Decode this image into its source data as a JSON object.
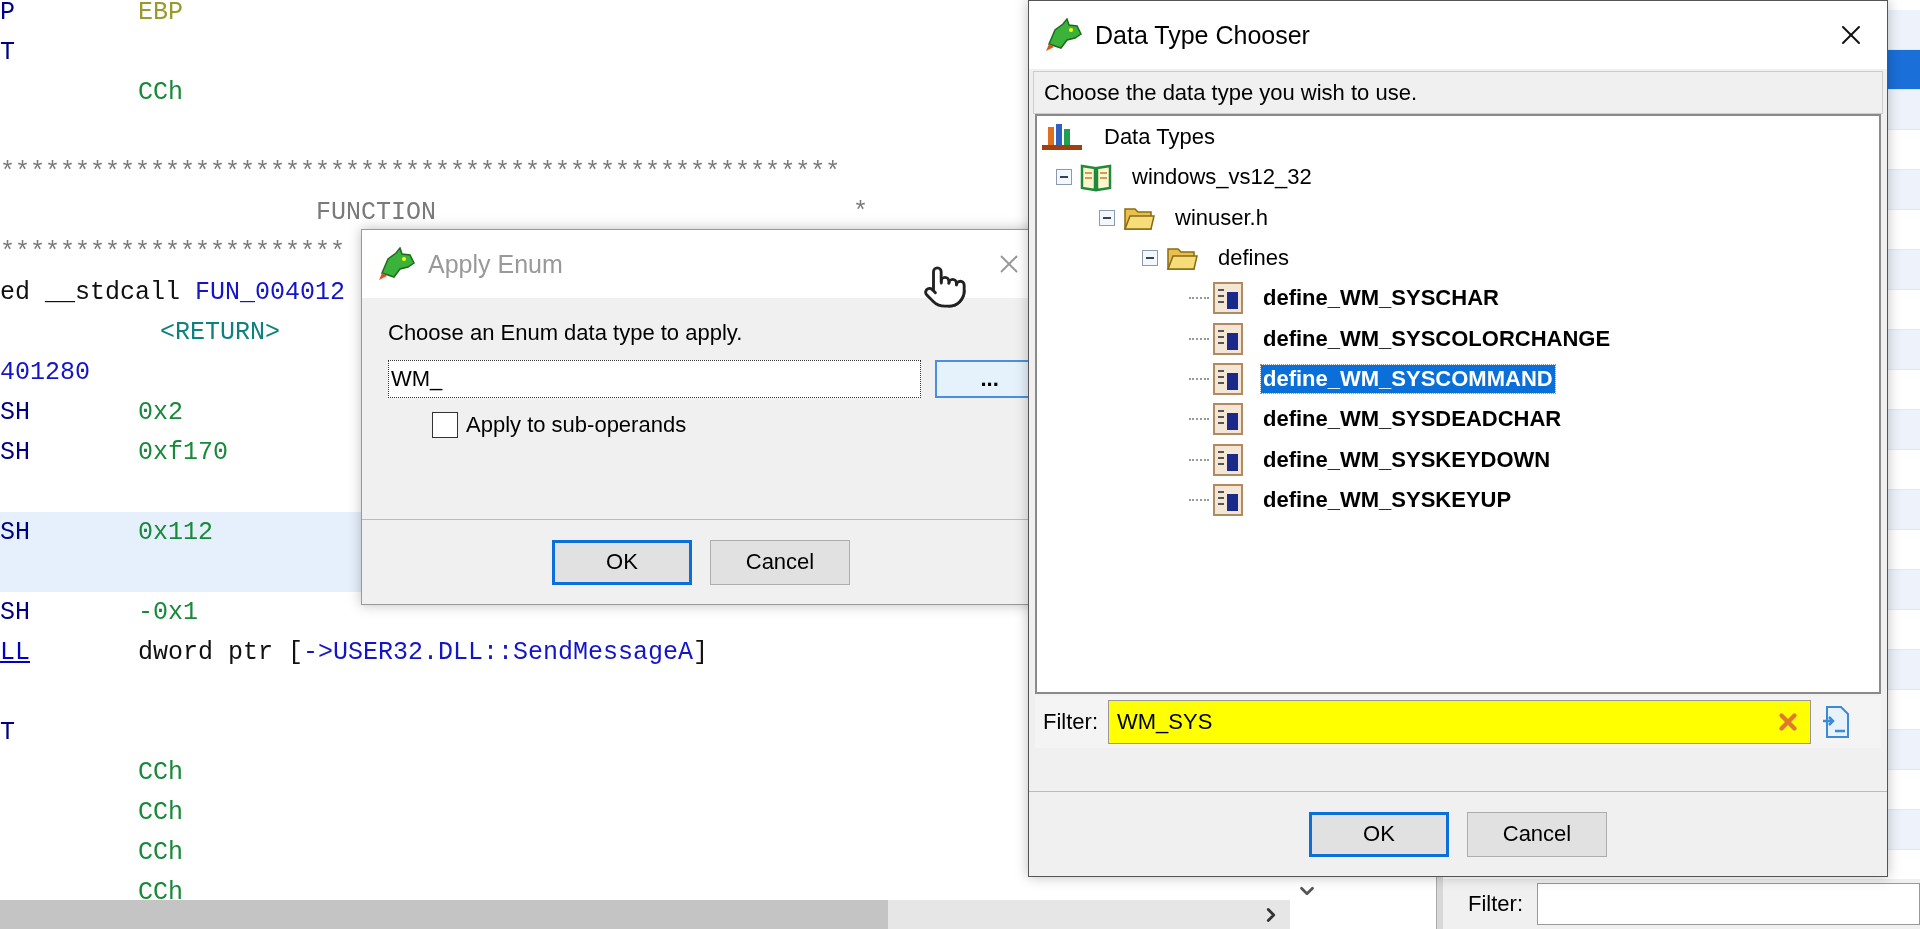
{
  "listing": {
    "lines": [
      {
        "kind": "instr",
        "mnemonic": "P",
        "operand": [
          {
            "text": "EBP",
            "kind": "register"
          }
        ],
        "selected": false
      },
      {
        "kind": "instr",
        "mnemonic": "T",
        "selected": false
      },
      {
        "kind": "instr",
        "operand": [
          {
            "text": "CCh",
            "kind": "scalar"
          }
        ],
        "selected": false
      },
      {
        "kind": "blank",
        "selected": false
      },
      {
        "kind": "stars",
        "text": "********************************************************",
        "selected": false
      },
      {
        "kind": "title",
        "text": "FUNCTION",
        "end": "*",
        "selected": false
      },
      {
        "kind": "stars",
        "text": "***********************",
        "selected": false
      },
      {
        "kind": "signature",
        "parts": [
          {
            "text": "ed __stdcall ",
            "kind": "plain"
          },
          {
            "text": "FUN_004012",
            "kind": "label"
          }
        ],
        "selected": false
      },
      {
        "kind": "return",
        "text": "<RETURN>",
        "selected": false
      },
      {
        "kind": "address",
        "text": "401280",
        "selected": false
      },
      {
        "kind": "instr",
        "mnemonic": "SH",
        "operand": [
          {
            "text": "0x2",
            "kind": "scalar"
          }
        ],
        "selected": false
      },
      {
        "kind": "instr",
        "mnemonic": "SH",
        "operand": [
          {
            "text": "0xf170",
            "kind": "scalar"
          }
        ],
        "selected": false
      },
      {
        "kind": "blank",
        "selected": false
      },
      {
        "kind": "instr",
        "mnemonic": "SH",
        "operand": [
          {
            "text": "0x112",
            "kind": "scalar"
          }
        ],
        "selected": true
      },
      {
        "kind": "blank",
        "selected": true
      },
      {
        "kind": "instr",
        "mnemonic": "SH",
        "operand": [
          {
            "text": "-0x1",
            "kind": "scalar"
          }
        ],
        "selected": false
      },
      {
        "kind": "instr",
        "mnemonic": "LL",
        "mnemonic_link": true,
        "operand": [
          {
            "text": "dword ptr [",
            "kind": "plain"
          },
          {
            "text": "->USER32.DLL::SendMessageA",
            "kind": "label"
          },
          {
            "text": "]",
            "kind": "plain"
          }
        ],
        "selected": false
      },
      {
        "kind": "blank",
        "selected": false
      },
      {
        "kind": "instr",
        "mnemonic": "T",
        "selected": false
      },
      {
        "kind": "instr",
        "operand": [
          {
            "text": "CCh",
            "kind": "scalar"
          }
        ],
        "selected": false
      },
      {
        "kind": "instr",
        "operand": [
          {
            "text": "CCh",
            "kind": "scalar"
          }
        ],
        "selected": false
      },
      {
        "kind": "instr",
        "operand": [
          {
            "text": "CCh",
            "kind": "scalar"
          }
        ],
        "selected": false
      },
      {
        "kind": "instr",
        "operand": [
          {
            "text": "CCh",
            "kind": "scalar"
          }
        ],
        "selected": false
      }
    ]
  },
  "side_list": {
    "rows": [
      {
        "selected": false
      },
      {
        "selected": true
      },
      {
        "selected": false
      },
      {
        "selected": false
      },
      {
        "selected": false
      },
      {
        "selected": false
      },
      {
        "selected": false
      },
      {
        "selected": false
      },
      {
        "selected": false
      },
      {
        "selected": false
      },
      {
        "selected": false
      },
      {
        "selected": false
      },
      {
        "selected": false
      },
      {
        "selected": false
      },
      {
        "selected": false
      },
      {
        "selected": false
      },
      {
        "selected": false
      },
      {
        "selected": false
      },
      {
        "selected": false
      },
      {
        "selected": false
      },
      {
        "selected": false
      }
    ],
    "filter": {
      "label": "Filter:"
    }
  },
  "apply_enum": {
    "title": "Apply Enum",
    "prompt": "Choose an Enum data type to apply.",
    "value": "WM_",
    "browse": "...",
    "checkbox": {
      "label": "Apply to sub-operands",
      "checked": false
    },
    "buttons": [
      {
        "label": "OK",
        "default": true
      },
      {
        "label": "Cancel",
        "default": false
      }
    ]
  },
  "chooser": {
    "title": "Data Type Chooser",
    "prompt": "Choose the data type you wish to use.",
    "tree": [
      {
        "label": "Data Types",
        "kind": "root",
        "children": [
          {
            "label": "windows_vs12_32",
            "kind": "archive",
            "expanded": true,
            "children": [
              {
                "label": "winuser.h",
                "kind": "folder",
                "expanded": true,
                "children": [
                  {
                    "label": "defines",
                    "kind": "folder",
                    "expanded": true,
                    "children": [
                      {
                        "label": "define_WM_SYSCHAR",
                        "kind": "enum",
                        "selected": false
                      },
                      {
                        "label": "define_WM_SYSCOLORCHANGE",
                        "kind": "enum",
                        "selected": false
                      },
                      {
                        "label": "define_WM_SYSCOMMAND",
                        "kind": "enum",
                        "selected": true
                      },
                      {
                        "label": "define_WM_SYSDEADCHAR",
                        "kind": "enum",
                        "selected": false
                      },
                      {
                        "label": "define_WM_SYSKEYDOWN",
                        "kind": "enum",
                        "selected": false
                      },
                      {
                        "label": "define_WM_SYSKEYUP",
                        "kind": "enum",
                        "selected": false
                      }
                    ]
                  }
                ]
              }
            ]
          }
        ]
      }
    ],
    "filter": {
      "label": "Filter:",
      "value": "WM_SYS"
    },
    "buttons": [
      {
        "label": "OK",
        "default": true
      },
      {
        "label": "Cancel",
        "default": false
      }
    ]
  }
}
